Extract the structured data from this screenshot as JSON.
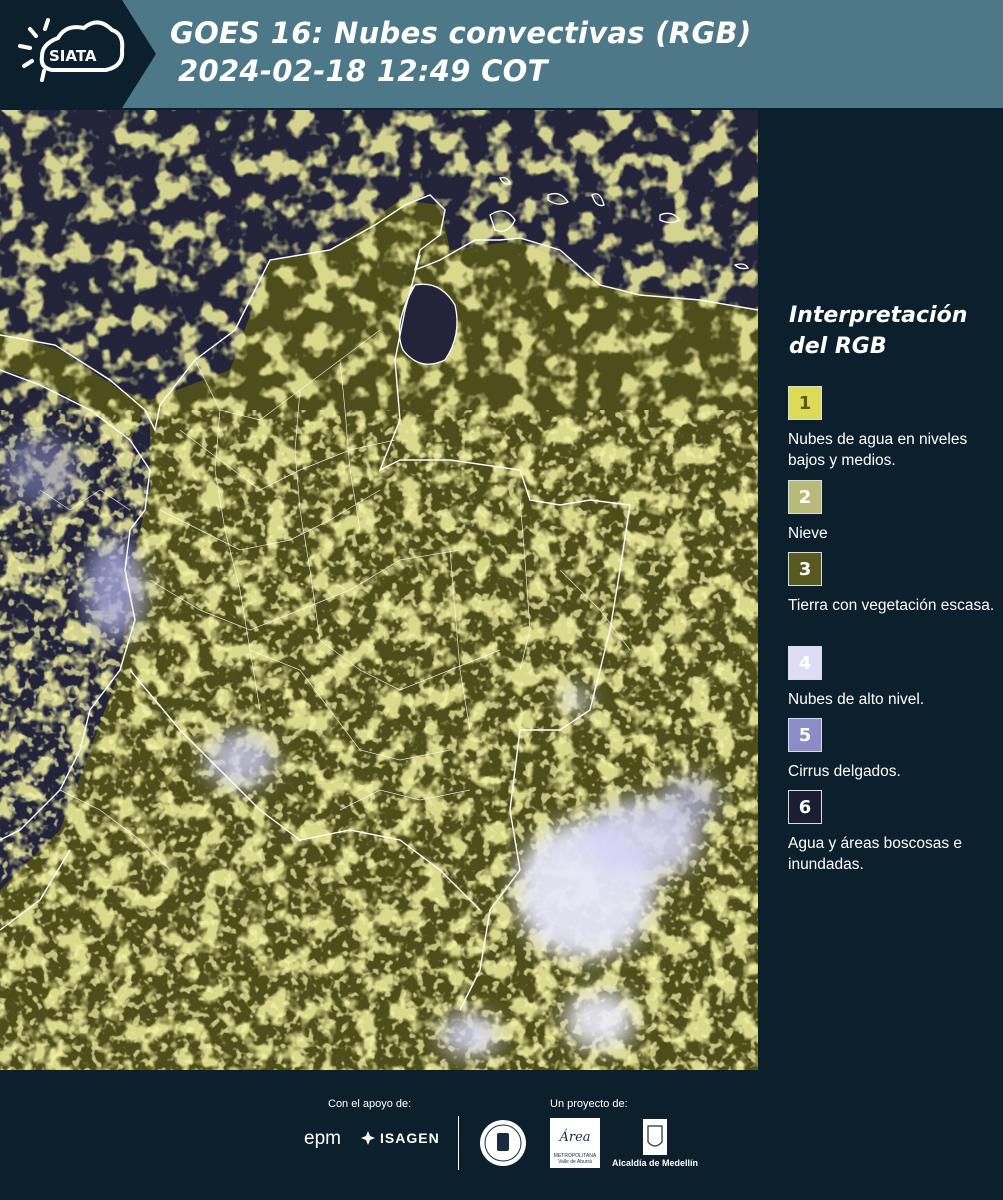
{
  "header": {
    "title_line1": "GOES 16: Nubes convectivas (RGB)",
    "title_line2": "2024-02-18 12:49 COT",
    "logo_text": "SIATA"
  },
  "map": {
    "description_icon": "satellite-rgb-map",
    "colors": {
      "background": "#23243a",
      "land": "#5a5a1e",
      "low_clouds": "#e6e35a",
      "high_clouds": "#d8d8f6",
      "borders": "#ffffff"
    }
  },
  "legend": {
    "title": "Interpretación del RGB",
    "items": [
      {
        "number": "1",
        "label": "Nubes de agua en niveles bajos y medios.",
        "color": "#dcdb56",
        "text_color": "#5a5a20"
      },
      {
        "number": "2",
        "label": "Nieve",
        "color": "#b9b97a",
        "text_color": "#ffffff"
      },
      {
        "number": "3",
        "label": "Tierra con vegetación escasa.",
        "color": "#5a5a20",
        "text_color": "#ffffff"
      },
      {
        "number": "4",
        "label": "Nubes de alto nivel.",
        "color": "#dedcf6",
        "text_color": "#ffffff"
      },
      {
        "number": "5",
        "label": "Cirrus delgados.",
        "color": "#8c8cc8",
        "text_color": "#ffffff"
      },
      {
        "number": "6",
        "label": "Agua y áreas boscosas e inundadas.",
        "color": "#1b1d33",
        "text_color": "#ffffff"
      }
    ]
  },
  "footer": {
    "support_caption": "Con el apoyo de:",
    "project_caption": "Un proyecto de:",
    "sponsor_epm": "epm",
    "sponsor_isagen": "ISAGEN",
    "area_logo_text": "Área",
    "area_logo_sub": "METROPOLITANA Valle de Aburrá",
    "alcaldia_label": "Alcaldía de Medellín"
  }
}
